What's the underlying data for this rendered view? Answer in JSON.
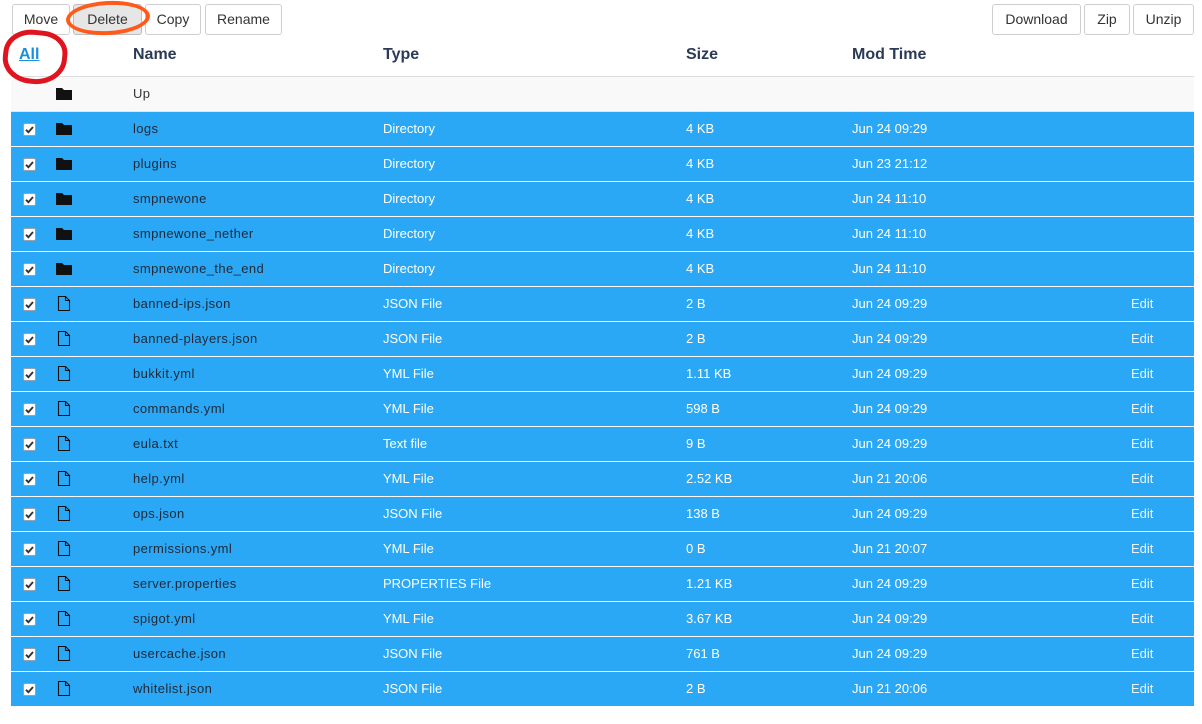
{
  "toolbar": {
    "move": "Move",
    "delete": "Delete",
    "copy": "Copy",
    "rename": "Rename",
    "download": "Download",
    "zip": "Zip",
    "unzip": "Unzip"
  },
  "header": {
    "all": "All",
    "name": "Name",
    "type": "Type",
    "size": "Size",
    "mod_time": "Mod Time"
  },
  "colors": {
    "selected_row": "#2aa8f5",
    "annotation_orange": "#ff5a1a",
    "annotation_red": "#e0141e",
    "link": "#1a8fdc"
  },
  "up_row": {
    "name": "Up",
    "icon": "folder-icon"
  },
  "rows": [
    {
      "name": "logs",
      "type": "Directory",
      "size": "4 KB",
      "mod": "Jun 24 09:29",
      "edit": "",
      "icon": "folder-icon",
      "checked": true
    },
    {
      "name": "plugins",
      "type": "Directory",
      "size": "4 KB",
      "mod": "Jun 23 21:12",
      "edit": "",
      "icon": "folder-icon",
      "checked": true
    },
    {
      "name": "smpnewone",
      "type": "Directory",
      "size": "4 KB",
      "mod": "Jun 24 11:10",
      "edit": "",
      "icon": "folder-icon",
      "checked": true
    },
    {
      "name": "smpnewone_nether",
      "type": "Directory",
      "size": "4 KB",
      "mod": "Jun 24 11:10",
      "edit": "",
      "icon": "folder-icon",
      "checked": true
    },
    {
      "name": "smpnewone_the_end",
      "type": "Directory",
      "size": "4 KB",
      "mod": "Jun 24 11:10",
      "edit": "",
      "icon": "folder-icon",
      "checked": true
    },
    {
      "name": "banned-ips.json",
      "type": "JSON File",
      "size": "2 B",
      "mod": "Jun 24 09:29",
      "edit": "Edit",
      "icon": "file-icon",
      "checked": true
    },
    {
      "name": "banned-players.json",
      "type": "JSON File",
      "size": "2 B",
      "mod": "Jun 24 09:29",
      "edit": "Edit",
      "icon": "file-icon",
      "checked": true
    },
    {
      "name": "bukkit.yml",
      "type": "YML File",
      "size": "1.11 KB",
      "mod": "Jun 24 09:29",
      "edit": "Edit",
      "icon": "file-icon",
      "checked": true
    },
    {
      "name": "commands.yml",
      "type": "YML File",
      "size": "598 B",
      "mod": "Jun 24 09:29",
      "edit": "Edit",
      "icon": "file-icon",
      "checked": true
    },
    {
      "name": "eula.txt",
      "type": "Text file",
      "size": "9 B",
      "mod": "Jun 24 09:29",
      "edit": "Edit",
      "icon": "file-icon",
      "checked": true
    },
    {
      "name": "help.yml",
      "type": "YML File",
      "size": "2.52 KB",
      "mod": "Jun 21 20:06",
      "edit": "Edit",
      "icon": "file-icon",
      "checked": true
    },
    {
      "name": "ops.json",
      "type": "JSON File",
      "size": "138 B",
      "mod": "Jun 24 09:29",
      "edit": "Edit",
      "icon": "file-icon",
      "checked": true
    },
    {
      "name": "permissions.yml",
      "type": "YML File",
      "size": "0 B",
      "mod": "Jun 21 20:07",
      "edit": "Edit",
      "icon": "file-icon",
      "checked": true
    },
    {
      "name": "server.properties",
      "type": "PROPERTIES File",
      "size": "1.21 KB",
      "mod": "Jun 24 09:29",
      "edit": "Edit",
      "icon": "file-icon",
      "checked": true
    },
    {
      "name": "spigot.yml",
      "type": "YML File",
      "size": "3.67 KB",
      "mod": "Jun 24 09:29",
      "edit": "Edit",
      "icon": "file-icon",
      "checked": true
    },
    {
      "name": "usercache.json",
      "type": "JSON File",
      "size": "761 B",
      "mod": "Jun 24 09:29",
      "edit": "Edit",
      "icon": "file-icon",
      "checked": true
    },
    {
      "name": "whitelist.json",
      "type": "JSON File",
      "size": "2 B",
      "mod": "Jun 21 20:06",
      "edit": "Edit",
      "icon": "file-icon",
      "checked": true
    }
  ]
}
